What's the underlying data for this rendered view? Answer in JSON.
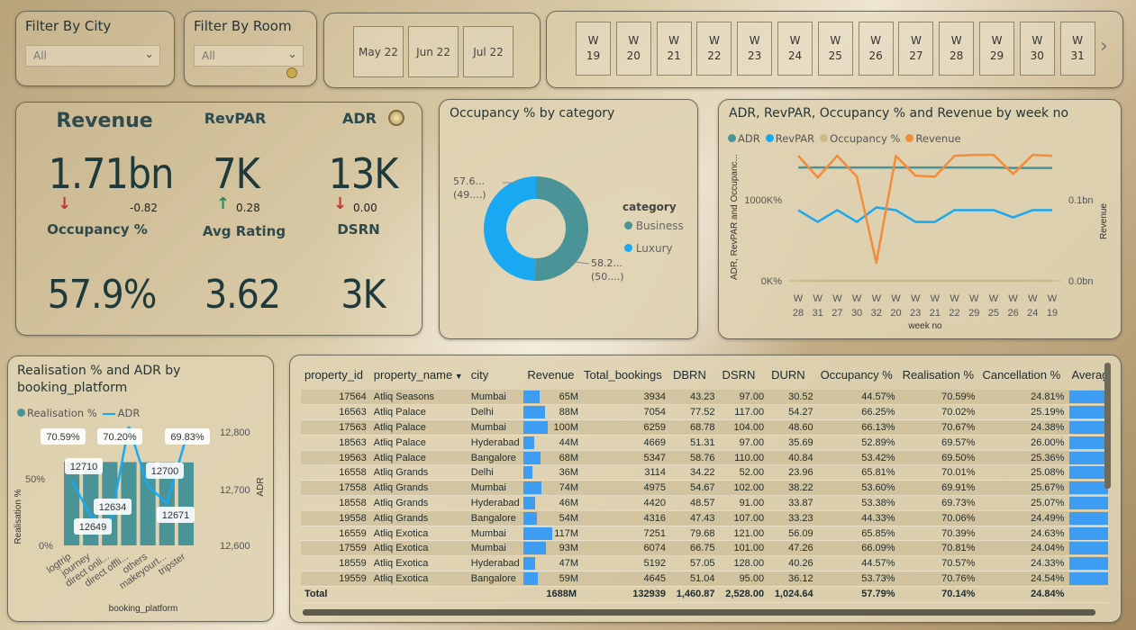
{
  "filters": {
    "city": {
      "title": "Filter By City",
      "value": "All"
    },
    "room": {
      "title": "Filter By Room",
      "value": "All"
    }
  },
  "months": [
    "May 22",
    "Jun 22",
    "Jul 22"
  ],
  "weeks": [
    {
      "a": "W",
      "b": "19"
    },
    {
      "a": "W",
      "b": "20"
    },
    {
      "a": "W",
      "b": "21"
    },
    {
      "a": "W",
      "b": "22"
    },
    {
      "a": "W",
      "b": "23"
    },
    {
      "a": "W",
      "b": "24"
    },
    {
      "a": "W",
      "b": "25"
    },
    {
      "a": "W",
      "b": "26"
    },
    {
      "a": "W",
      "b": "27"
    },
    {
      "a": "W",
      "b": "28"
    },
    {
      "a": "W",
      "b": "29"
    },
    {
      "a": "W",
      "b": "30"
    },
    {
      "a": "W",
      "b": "31"
    }
  ],
  "weeks_next": "›",
  "kpis": {
    "revenue": {
      "label": "Revenue",
      "value": "1.71bn",
      "delta": "-0.82",
      "trend": "down"
    },
    "revpar": {
      "label": "RevPAR",
      "value": "7K",
      "delta": "0.28",
      "trend": "up"
    },
    "adr": {
      "label": "ADR",
      "value": "13K",
      "delta": "0.00",
      "trend": "down"
    },
    "occupancy": {
      "label": "Occupancy %",
      "value": "57.9%"
    },
    "avg_rating": {
      "label": "Avg Rating",
      "value": "3.62"
    },
    "dsrn": {
      "label": "DSRN",
      "value": "3K"
    }
  },
  "donut": {
    "title": "Occupancy % by category",
    "legend_title": "category",
    "colors": {
      "Business": "#4a9396",
      "Luxury": "#19a9f2"
    },
    "label_luxury_1": "57.6...",
    "label_luxury_2": "(49....)",
    "label_business_1": "58.2...",
    "label_business_2": "(50....)",
    "chart_data": {
      "type": "pie",
      "categories": [
        "Business",
        "Luxury"
      ],
      "values": [
        50.3,
        49.7
      ],
      "labels": [
        "58.2... (50....)",
        "57.6... (49....)"
      ]
    }
  },
  "weekly": {
    "title": "ADR, RevPAR, Occupancy % and Revenue by week no",
    "legend": [
      {
        "name": "ADR",
        "color": "#4a9396"
      },
      {
        "name": "RevPAR",
        "color": "#19a9f2"
      },
      {
        "name": "Occupancy %",
        "color": "#c9bb8a"
      },
      {
        "name": "Revenue",
        "color": "#f28c3a"
      }
    ],
    "y_left_ticks": [
      "1000K%",
      "0K%"
    ],
    "y_left_label": "ADR, RevPAR and Occupanc...",
    "y_right_ticks": [
      "0.1bn",
      "0.0bn"
    ],
    "y_right_label": "Revenue",
    "x_label": "week no",
    "x_ticks": [
      "28",
      "31",
      "27",
      "30",
      "32",
      "20",
      "23",
      "21",
      "22",
      "29",
      "25",
      "26",
      "24",
      "19"
    ],
    "x_prefix": "W",
    "chart_data": {
      "type": "line",
      "x": [
        "W 28",
        "W 31",
        "W 27",
        "W 30",
        "W 32",
        "W 20",
        "W 23",
        "W 21",
        "W 22",
        "W 29",
        "W 25",
        "W 26",
        "W 24",
        "W 19"
      ],
      "series": [
        {
          "name": "ADR",
          "axis": "left",
          "values": [
            1250,
            1250,
            1250,
            1250,
            1250,
            1250,
            1250,
            1250,
            1250,
            1250,
            1250,
            1245,
            1245,
            1245
          ]
        },
        {
          "name": "RevPAR",
          "axis": "left",
          "values": [
            780,
            650,
            780,
            650,
            810,
            780,
            650,
            650,
            780,
            780,
            780,
            700,
            780,
            780
          ]
        },
        {
          "name": "Occupancy %",
          "axis": "left",
          "values": [
            0,
            0,
            0,
            0,
            0,
            0,
            0,
            0,
            0,
            0,
            0,
            0,
            0,
            0
          ]
        },
        {
          "name": "Revenue",
          "axis": "right",
          "values": [
            0.138,
            0.114,
            0.138,
            0.115,
            0.02,
            0.138,
            0.116,
            0.115,
            0.138,
            0.139,
            0.139,
            0.118,
            0.139,
            0.138
          ]
        }
      ],
      "y_left_range": [
        0,
        1500
      ],
      "y_right_range": [
        0,
        0.15
      ]
    }
  },
  "realisation": {
    "title": "Realisation % and ADR by booking_platform",
    "legend": [
      {
        "name": "Realisation %",
        "color": "#4a9396"
      },
      {
        "name": "ADR",
        "color": "#19a9f2"
      }
    ],
    "y_left_label": "Realisation %",
    "y_left_ticks": [
      "50%",
      "0%"
    ],
    "y_right_label": "ADR",
    "y_right_ticks": [
      "12,800",
      "12,700",
      "12,600"
    ],
    "x_label": "booking_platform",
    "chart_data": {
      "type": "bar",
      "categories": [
        "logtrip",
        "journey",
        "direct onli...",
        "direct offli...",
        "others",
        "makeyourt...",
        "tripster"
      ],
      "series": [
        {
          "name": "Realisation %",
          "values": [
            70.59,
            70.25,
            70.2,
            70.1,
            70.0,
            69.9,
            69.83
          ]
        },
        {
          "name": "ADR",
          "values": [
            12710,
            12649,
            12634,
            12800,
            12700,
            12671,
            12780
          ]
        }
      ],
      "data_labels_real": [
        "70.59%",
        "70.20%",
        "69.83%"
      ],
      "data_labels_adr": [
        "12710",
        "12649",
        "12634",
        "12700",
        "12671"
      ],
      "y_left_range": [
        0,
        100
      ],
      "y_right_range": [
        12600,
        12800
      ]
    }
  },
  "table": {
    "columns": [
      "property_id",
      "property_name",
      "city",
      "Revenue",
      "Total_bookings",
      "DBRN",
      "DSRN",
      "DURN",
      "Occupancy %",
      "Realisation %",
      "Cancellation %",
      "Average F"
    ],
    "sort_indicator": "▼",
    "rows": [
      [
        "17564",
        "Atliq Seasons",
        "Mumbai",
        "65M",
        "3934",
        "43.23",
        "97.00",
        "30.52",
        "44.57%",
        "70.59%",
        "24.81%"
      ],
      [
        "16563",
        "Atliq Palace",
        "Delhi",
        "88M",
        "7054",
        "77.52",
        "117.00",
        "54.27",
        "66.25%",
        "70.02%",
        "25.19%"
      ],
      [
        "17563",
        "Atliq Palace",
        "Mumbai",
        "100M",
        "6259",
        "68.78",
        "104.00",
        "48.60",
        "66.13%",
        "70.67%",
        "24.38%"
      ],
      [
        "18563",
        "Atliq Palace",
        "Hyderabad",
        "44M",
        "4669",
        "51.31",
        "97.00",
        "35.69",
        "52.89%",
        "69.57%",
        "26.00%"
      ],
      [
        "19563",
        "Atliq Palace",
        "Bangalore",
        "68M",
        "5347",
        "58.76",
        "110.00",
        "40.84",
        "53.42%",
        "69.50%",
        "25.36%"
      ],
      [
        "16558",
        "Atliq Grands",
        "Delhi",
        "36M",
        "3114",
        "34.22",
        "52.00",
        "23.96",
        "65.81%",
        "70.01%",
        "25.08%"
      ],
      [
        "17558",
        "Atliq Grands",
        "Mumbai",
        "74M",
        "4975",
        "54.67",
        "102.00",
        "38.22",
        "53.60%",
        "69.91%",
        "25.67%"
      ],
      [
        "18558",
        "Atliq Grands",
        "Hyderabad",
        "46M",
        "4420",
        "48.57",
        "91.00",
        "33.87",
        "53.38%",
        "69.73%",
        "25.07%"
      ],
      [
        "19558",
        "Atliq Grands",
        "Bangalore",
        "54M",
        "4316",
        "47.43",
        "107.00",
        "33.23",
        "44.33%",
        "70.06%",
        "24.49%"
      ],
      [
        "16559",
        "Atliq Exotica",
        "Mumbai",
        "117M",
        "7251",
        "79.68",
        "121.00",
        "56.09",
        "65.85%",
        "70.39%",
        "24.63%"
      ],
      [
        "17559",
        "Atliq Exotica",
        "Mumbai",
        "93M",
        "6074",
        "66.75",
        "101.00",
        "47.26",
        "66.09%",
        "70.81%",
        "24.04%"
      ],
      [
        "18559",
        "Atliq Exotica",
        "Hyderabad",
        "47M",
        "5192",
        "57.05",
        "128.00",
        "40.26",
        "44.57%",
        "70.57%",
        "24.33%"
      ],
      [
        "19559",
        "Atliq Exotica",
        "Bangalore",
        "59M",
        "4645",
        "51.04",
        "95.00",
        "36.12",
        "53.73%",
        "70.76%",
        "24.54%"
      ]
    ],
    "revenue_values_m": [
      65,
      88,
      100,
      44,
      68,
      36,
      74,
      46,
      54,
      117,
      93,
      47,
      59
    ],
    "avg_rating_fill": [
      0.85,
      1,
      1,
      1,
      1,
      1,
      1,
      1,
      0.9,
      1,
      1,
      1,
      1
    ],
    "total": [
      "Total",
      "",
      "",
      "1688M",
      "132939",
      "1,460.87",
      "2,528.00",
      "1,024.64",
      "57.79%",
      "70.14%",
      "24.84%"
    ]
  }
}
